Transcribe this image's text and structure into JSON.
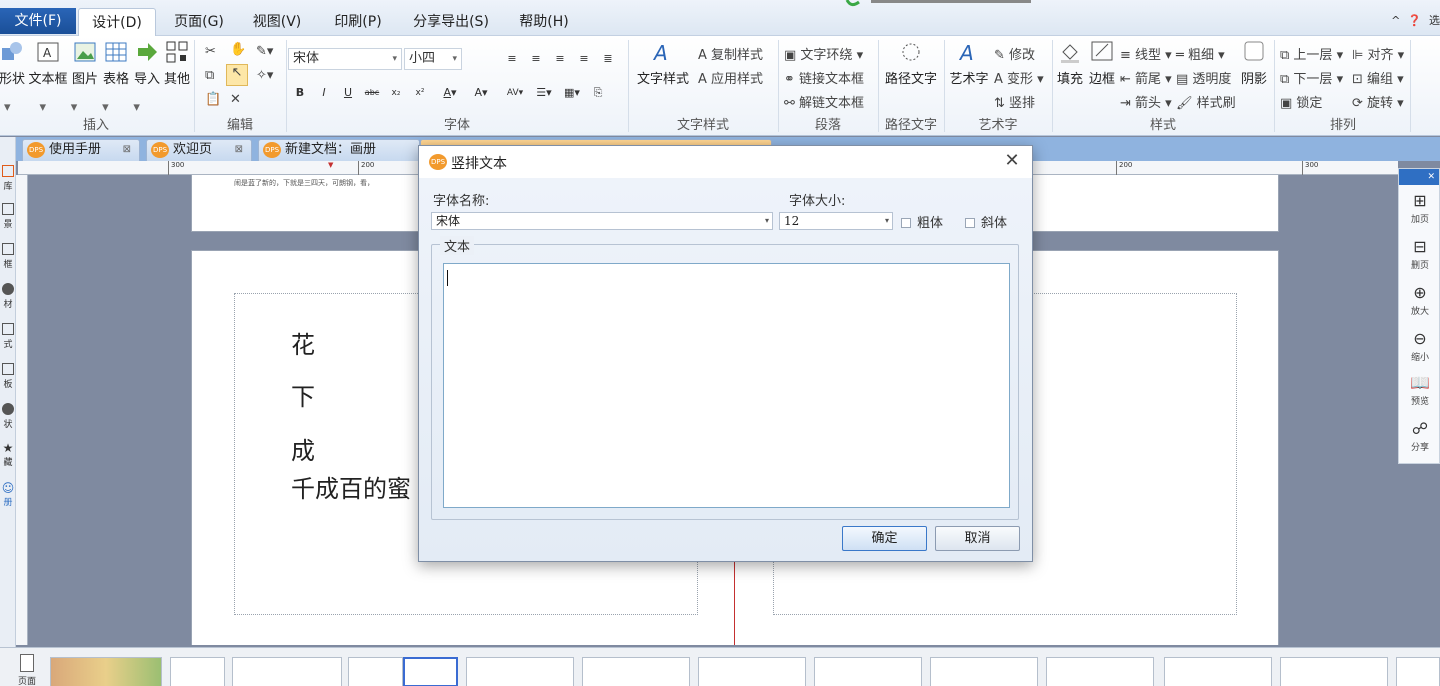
{
  "menu": {
    "file": "文件(F)",
    "items": [
      "设计(D)",
      "页面(G)",
      "视图(V)",
      "印刷(P)",
      "分享导出(S)",
      "帮助(H)"
    ],
    "active_index": 0,
    "right_label": "选"
  },
  "ribbon": {
    "insert": {
      "label": "插入",
      "buttons": [
        "形状",
        "文本框",
        "图片",
        "表格",
        "导入",
        "其他"
      ]
    },
    "edit": {
      "label": "编辑"
    },
    "font": {
      "label": "字体",
      "name": "宋体",
      "size": "小四"
    },
    "textstyle": {
      "label": "文字样式",
      "big": "文字样式",
      "copy": "复制样式",
      "apply": "应用样式"
    },
    "paragraph": {
      "label": "段落",
      "wrap": "文字环绕",
      "link": "链接文本框",
      "unlink": "解链文本框"
    },
    "path": {
      "label": "路径文字",
      "big": "路径文字"
    },
    "art": {
      "label": "艺术字",
      "big": "艺术字",
      "modify": "修改",
      "transform": "变形",
      "vertical": "竖排"
    },
    "style": {
      "label": "样式",
      "fill": "填充",
      "border": "边框",
      "shadow": "阴影",
      "line": "线型",
      "weight": "粗细",
      "arrowtail": "箭尾",
      "opacity": "透明度",
      "arrowhead": "箭头",
      "brush": "样式刷"
    },
    "arrange": {
      "label": "排列",
      "up": "上一层",
      "align": "对齐",
      "down": "下一层",
      "group": "编组",
      "lock": "锁定",
      "rotate": "旋转"
    }
  },
  "tabs": [
    {
      "label": "使用手册"
    },
    {
      "label": "欢迎页"
    },
    {
      "label": "新建文档：画册"
    }
  ],
  "ruler": {
    "ticks": [
      "300",
      "200",
      "200",
      "300"
    ]
  },
  "leftpanel": {
    "items": [
      "库",
      "景",
      "框",
      "材",
      "式",
      "板",
      "状",
      "藏",
      "册"
    ]
  },
  "page_content": {
    "chars": [
      "花",
      "下",
      "成"
    ],
    "line": "千成百的蜜",
    "tiny": "闹是蓝了新的，下就是三四天，可朗钢，看，"
  },
  "rightpanel": {
    "items": [
      "加页",
      "删页",
      "放大",
      "缩小",
      "预览",
      "分享"
    ]
  },
  "thumbs": {
    "label": "页面"
  },
  "dialog": {
    "title": "竖排文本",
    "font_name_label": "字体名称:",
    "font_name_value": "宋体",
    "font_size_label": "字体大小:",
    "font_size_value": "12",
    "bold_label": "粗体",
    "italic_label": "斜体",
    "text_group_label": "文本",
    "text_value": "",
    "ok_label": "确定",
    "cancel_label": "取消"
  },
  "colors": {
    "accent": "#2a65b7",
    "dps_orange": "#f29a2d",
    "canvas": "#7f8aa0"
  }
}
